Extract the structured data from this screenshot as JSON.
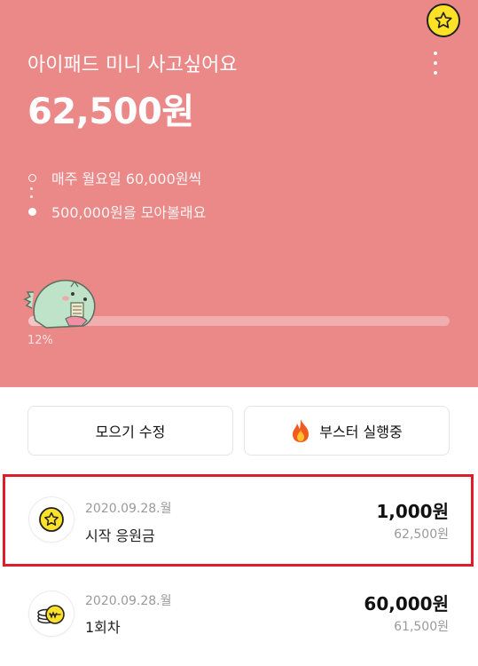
{
  "goal": {
    "title": "아이패드 미니 사고싶어요",
    "amount": "62,500원",
    "schedule": "매주 월요일 60,000원씩",
    "target": "500,000원을 모아볼래요",
    "progress_fraction": 0.12,
    "progress_label": "12%"
  },
  "icons": {
    "top_badge": "star-badge-icon",
    "menu": "more-vertical-icon",
    "mascot": "dino-mascot-icon",
    "boost": "flame-icon",
    "txn_start": "star-coin-icon",
    "txn_regular": "coin-stack-icon"
  },
  "actions": {
    "edit_label": "모으기 수정",
    "boost_label": "부스터 실행중"
  },
  "transactions": [
    {
      "date": "2020.09.28.월",
      "label": "시작 응원금",
      "amount": "1,000원",
      "balance": "62,500원"
    },
    {
      "date": "2020.09.28.월",
      "label": "1회차",
      "amount": "60,000원",
      "balance": "61,500원"
    }
  ],
  "colors": {
    "hero_bg": "#eb8888",
    "highlight_border": "#dc1e2a",
    "star_yellow": "#ffe227"
  }
}
